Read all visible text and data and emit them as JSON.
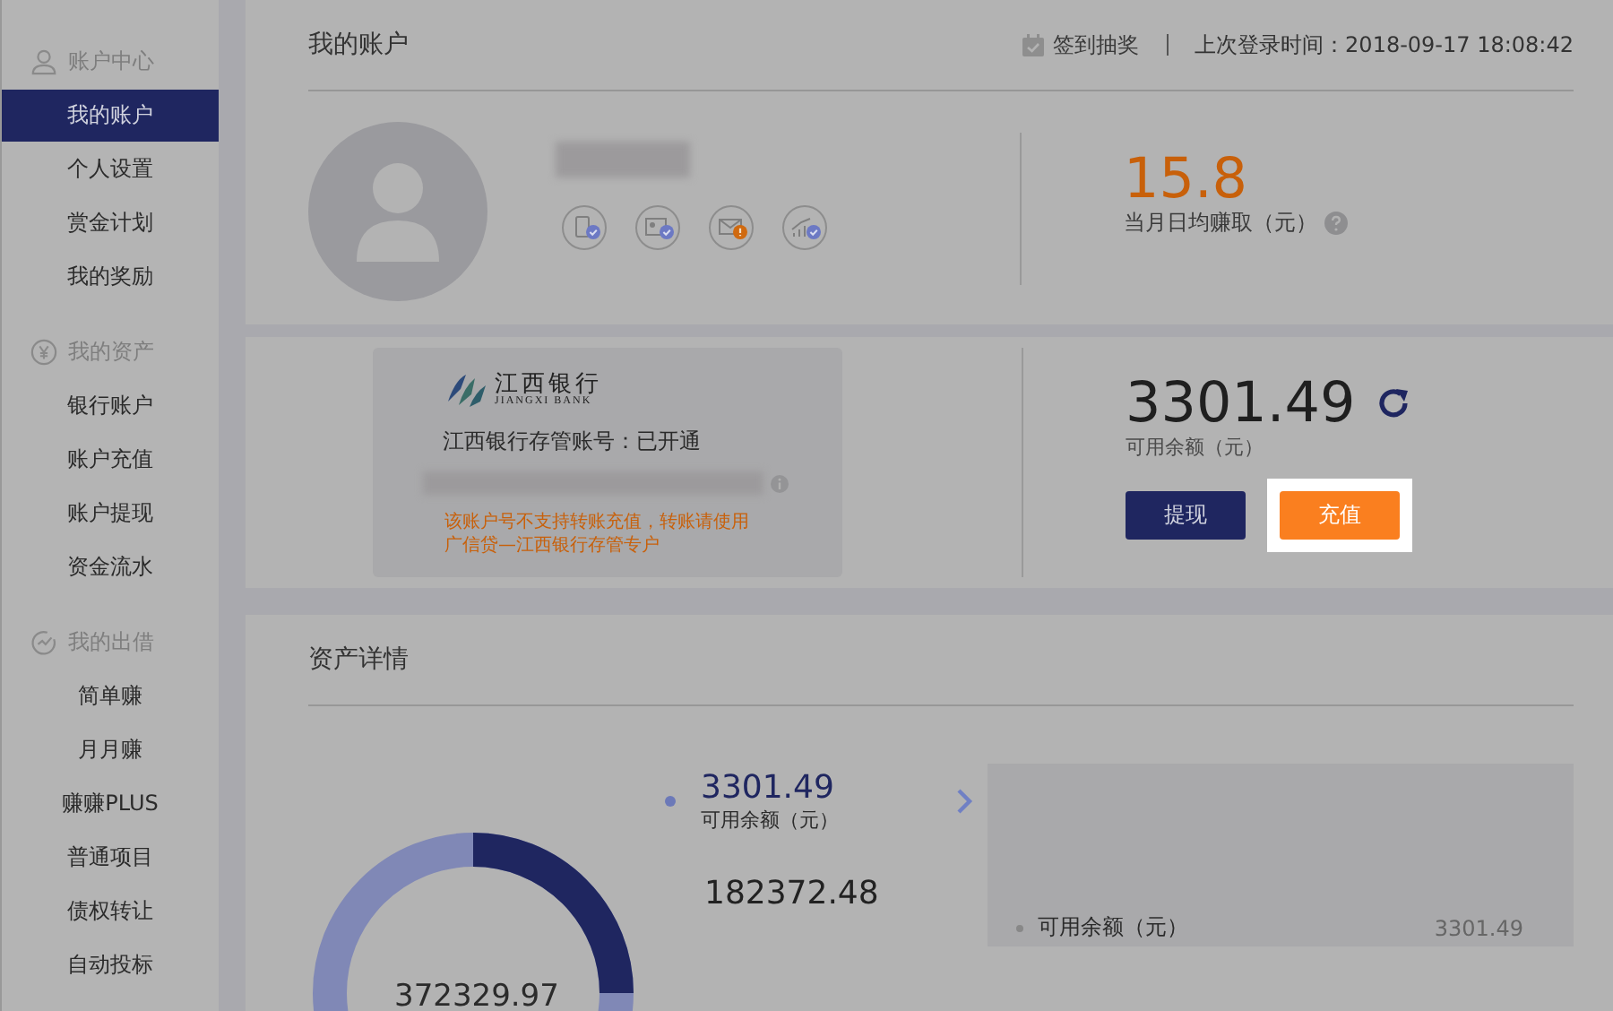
{
  "sidebar": {
    "groups": [
      {
        "title": "账户中心",
        "items": [
          {
            "label": "我的账户",
            "selected": true
          },
          {
            "label": "个人设置",
            "selected": false
          },
          {
            "label": "赏金计划",
            "selected": false
          },
          {
            "label": "我的奖励",
            "selected": false
          }
        ]
      },
      {
        "title": "我的资产",
        "items": [
          {
            "label": "银行账户",
            "selected": false
          },
          {
            "label": "账户充值",
            "selected": false
          },
          {
            "label": "账户提现",
            "selected": false
          },
          {
            "label": "资金流水",
            "selected": false
          }
        ]
      },
      {
        "title": "我的出借",
        "items": [
          {
            "label": "简单赚",
            "selected": false
          },
          {
            "label": "月月赚",
            "selected": false
          },
          {
            "label": "赚赚PLUS",
            "selected": false
          },
          {
            "label": "普通项目",
            "selected": false
          },
          {
            "label": "债权转让",
            "selected": false
          },
          {
            "label": "自动投标",
            "selected": false
          }
        ]
      }
    ]
  },
  "account": {
    "title": "我的账户",
    "sign_in": "签到抽奖",
    "last_login": "上次登录时间：2018-09-17 18:08:42",
    "verifications": [
      {
        "verified": true
      },
      {
        "verified": true
      },
      {
        "verified": false
      },
      {
        "verified": true
      }
    ],
    "daily_earning": "15.8",
    "daily_earning_label": "当月日均赚取（元）"
  },
  "bank": {
    "logo_cn": "江西银行",
    "logo_en": "JIANGXI BANK",
    "status": "江西银行存管账号：已开通",
    "notice": "该账户号不支持转账充值，转账请使用广信贷—江西银行存管专户",
    "balance": "3301.49",
    "balance_label": "可用余额（元）",
    "buttons": [
      {
        "label": "提现",
        "kind": "secondary",
        "highlighted": false
      },
      {
        "label": "充值",
        "kind": "primary",
        "highlighted": true
      }
    ]
  },
  "assets": {
    "title": "资产详情",
    "total": "372329.97",
    "legend": [
      {
        "value": "3301.49",
        "label": "可用余额（元）"
      },
      {
        "value": "182372.48"
      }
    ],
    "detail_rows": [
      {
        "label": "可用余额（元）",
        "value": "3301.49"
      }
    ]
  }
}
